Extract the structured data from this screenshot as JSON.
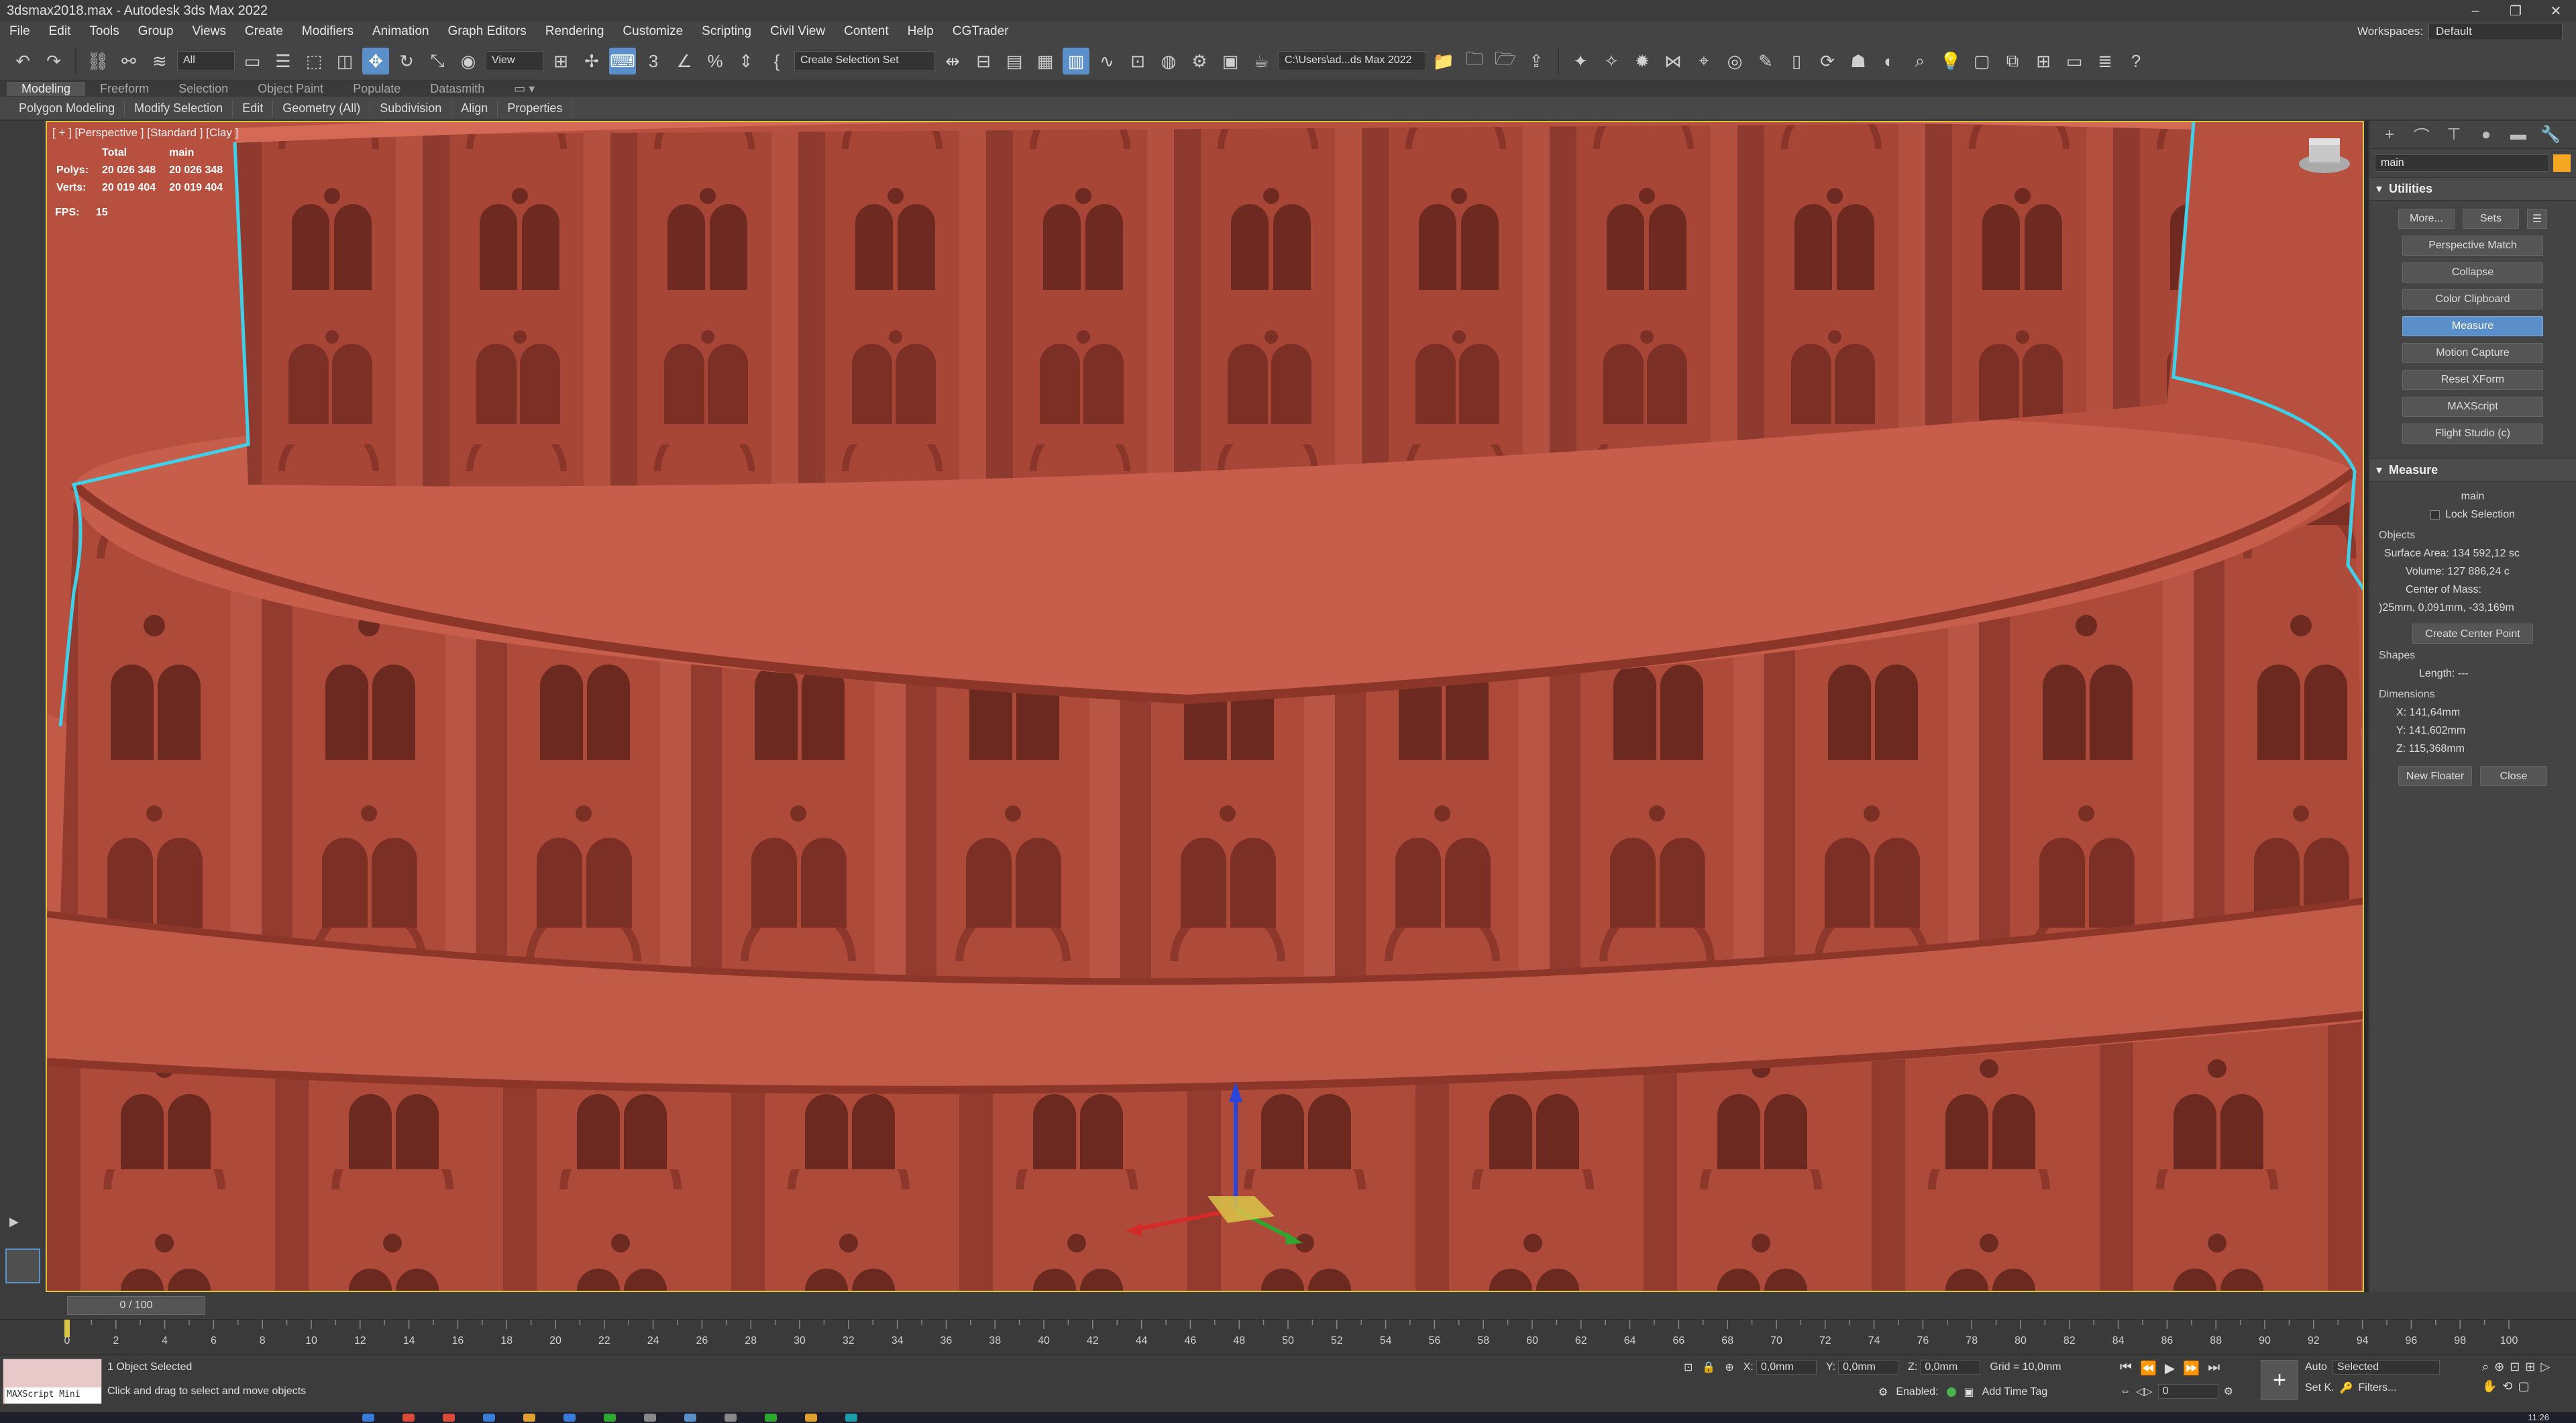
{
  "window": {
    "title": "3dsmax2018.max - Autodesk 3ds Max 2022",
    "controls": [
      "–",
      "❐",
      "✕"
    ]
  },
  "menu": {
    "items": [
      "File",
      "Edit",
      "Tools",
      "Group",
      "Views",
      "Create",
      "Modifiers",
      "Animation",
      "Graph Editors",
      "Rendering",
      "Customize",
      "Scripting",
      "Civil View",
      "Content",
      "Help",
      "CGTrader"
    ],
    "workspaces_label": "Workspaces:",
    "workspaces_value": "Default"
  },
  "toolbar": {
    "filter_dropdown": "All",
    "ref_coord_dropdown": "View",
    "selection_set_dropdown": "Create Selection Set",
    "project_path": "C:\\Users\\ad...ds Max 2022"
  },
  "ribbon": {
    "tabs": [
      "Modeling",
      "Freeform",
      "Selection",
      "Object Paint",
      "Populate",
      "Datasmith"
    ],
    "sub": [
      "Polygon Modeling",
      "Modify Selection",
      "Edit",
      "Geometry (All)",
      "Subdivision",
      "Align",
      "Properties"
    ]
  },
  "viewport": {
    "label": "[ + ] [Perspective ] [Standard ] [Clay ]",
    "stats": {
      "col_total": "Total",
      "col_main": "main",
      "polys_label": "Polys:",
      "polys_total": "20 026 348",
      "polys_main": "20 026 348",
      "verts_label": "Verts:",
      "verts_total": "20 019 404",
      "verts_main": "20 019 404",
      "fps_label": "FPS:",
      "fps_value": "15"
    },
    "colors": {
      "clay": "#b8503f",
      "selection_outline": "#3fd0e8",
      "border": "#d9c548"
    }
  },
  "command_panel": {
    "object_name": "main",
    "utilities_title": "Utilities",
    "more_button": "More...",
    "sets_button": "Sets",
    "utility_buttons": [
      "Perspective Match",
      "Collapse",
      "Color Clipboard",
      "Measure",
      "Motion Capture",
      "Reset XForm",
      "MAXScript",
      "Flight Studio (c)"
    ],
    "selected_utility": "Measure",
    "measure": {
      "title": "Measure",
      "object": "main",
      "lock_selection": "Lock Selection",
      "objects_label": "Objects",
      "surface_area": "Surface Area: 134 592,12 sc",
      "volume": "Volume: 127 886,24 c",
      "center_label": "Center of Mass:",
      "center_value": ")25mm, 0,091mm, -33,169m",
      "create_center_point": "Create Center Point",
      "shapes_label": "Shapes",
      "length": "Length: ---",
      "dimensions_label": "Dimensions",
      "dim_x": "X:  141,64mm",
      "dim_y": "Y:  141,602mm",
      "dim_z": "Z:  115,368mm",
      "new_floater": "New Floater",
      "close": "Close"
    }
  },
  "timeline": {
    "slider_label": "0 / 100",
    "ticks": [
      "0",
      "2",
      "4",
      "6",
      "8",
      "10",
      "12",
      "14",
      "16",
      "18",
      "20",
      "22",
      "24",
      "26",
      "28",
      "30",
      "32",
      "34",
      "36",
      "38",
      "40",
      "42",
      "44",
      "46",
      "48",
      "50",
      "52",
      "54",
      "56",
      "58",
      "60",
      "62",
      "64",
      "66",
      "68",
      "70",
      "72",
      "74",
      "76",
      "78",
      "80",
      "82",
      "84",
      "86",
      "88",
      "90",
      "92",
      "94",
      "96",
      "98",
      "100"
    ]
  },
  "status": {
    "maxscript_label": "MAXScript Mini",
    "selected": "1 Object Selected",
    "prompt": "Click and drag to select and move objects",
    "x_label": "X:",
    "x_value": "0,0mm",
    "y_label": "Y:",
    "y_value": "0,0mm",
    "z_label": "Z:",
    "z_value": "0,0mm",
    "grid": "Grid = 10,0mm",
    "enabled": "Enabled:",
    "add_time_tag": "Add Time Tag",
    "frame_value": "0",
    "auto": "Auto",
    "auto_value": "Selected",
    "set_key": "Set K.",
    "filters": "Filters...",
    "clock": "11:26"
  }
}
